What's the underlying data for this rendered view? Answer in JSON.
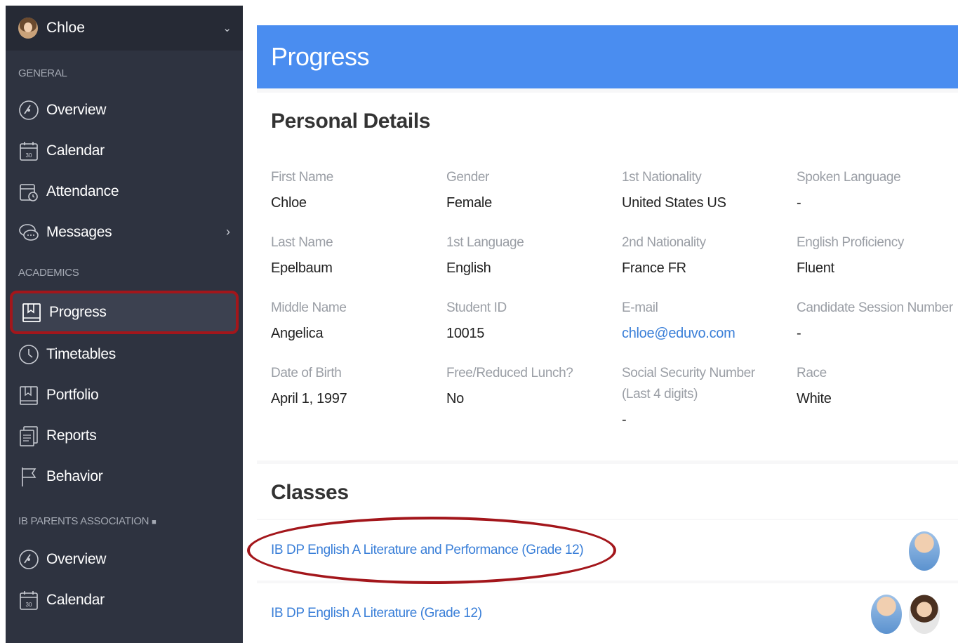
{
  "user": {
    "name": "Chloe"
  },
  "sidebar": {
    "general_label": "GENERAL",
    "general_items": [
      {
        "label": "Overview",
        "icon": "gauge-icon"
      },
      {
        "label": "Calendar",
        "icon": "calendar-icon"
      },
      {
        "label": "Attendance",
        "icon": "attendance-icon"
      },
      {
        "label": "Messages",
        "icon": "messages-icon"
      }
    ],
    "academics_label": "ACADEMICS",
    "academics_items": [
      {
        "label": "Progress",
        "icon": "bookmark-icon"
      },
      {
        "label": "Timetables",
        "icon": "clock-icon"
      },
      {
        "label": "Portfolio",
        "icon": "bookmark-icon"
      },
      {
        "label": "Reports",
        "icon": "reports-icon"
      },
      {
        "label": "Behavior",
        "icon": "flag-icon"
      }
    ],
    "association_label": "IB PARENTS ASSOCIATION",
    "association_items": [
      {
        "label": "Overview",
        "icon": "gauge-icon"
      },
      {
        "label": "Calendar",
        "icon": "calendar-icon"
      }
    ],
    "calendar_day": "30"
  },
  "page": {
    "title": "Progress"
  },
  "personal_details": {
    "title": "Personal Details",
    "fields": [
      {
        "label": "First Name",
        "value": "Chloe"
      },
      {
        "label": "Gender",
        "value": "Female"
      },
      {
        "label": "1st Nationality",
        "value": "United States US"
      },
      {
        "label": "Spoken Language",
        "value": "-"
      },
      {
        "label": "Last Name",
        "value": "Epelbaum"
      },
      {
        "label": "1st Language",
        "value": "English"
      },
      {
        "label": "2nd Nationality",
        "value": "France FR"
      },
      {
        "label": "English Proficiency",
        "value": "Fluent"
      },
      {
        "label": "Middle Name",
        "value": "Angelica"
      },
      {
        "label": "Student ID",
        "value": "10015"
      },
      {
        "label": "E-mail",
        "value": "chloe@eduvo.com"
      },
      {
        "label": "Candidate Session Number",
        "value": "-"
      },
      {
        "label": "Date of Birth",
        "value": "April 1, 1997"
      },
      {
        "label": "Free/Reduced Lunch?",
        "value": "No"
      },
      {
        "label": "Social Security Number (Last 4 digits)",
        "value": "-"
      },
      {
        "label": "Race",
        "value": "White"
      }
    ]
  },
  "classes": {
    "title": "Classes",
    "items": [
      {
        "name": "IB DP English A Literature and Performance (Grade 12)"
      },
      {
        "name": "IB DP English A Literature (Grade 12)"
      }
    ]
  },
  "colors": {
    "header": "#4a8df0",
    "sidebar": "#2e3340",
    "highlight": "#a3161b",
    "link": "#3a7fd8"
  }
}
